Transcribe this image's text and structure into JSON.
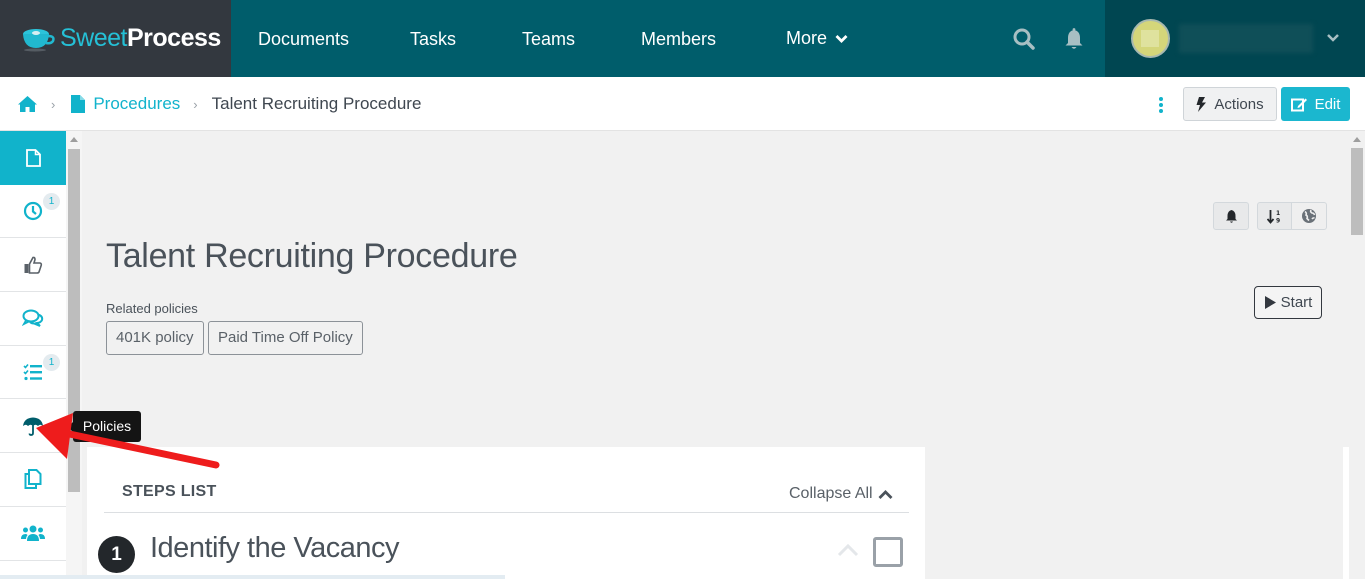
{
  "app": {
    "logo_sweet": "Sweet",
    "logo_process": "Process"
  },
  "topnav": {
    "items": [
      {
        "label": "Documents"
      },
      {
        "label": "Tasks"
      },
      {
        "label": "Teams"
      },
      {
        "label": "Members"
      },
      {
        "label": "More"
      }
    ],
    "search_icon": "search-icon",
    "bell_icon": "bell-icon"
  },
  "breadcrumb": {
    "home_icon": "home-icon",
    "procedures_label": "Procedures",
    "current_label": "Talent Recruiting Procedure",
    "separator": "›"
  },
  "toolbar": {
    "actions_label": "Actions",
    "edit_label": "Edit"
  },
  "sidebar": {
    "items": [
      {
        "icon": "document-icon",
        "active": true,
        "badge": ""
      },
      {
        "icon": "clock-icon",
        "active": false,
        "badge": "1"
      },
      {
        "icon": "thumbs-up-icon",
        "active": false,
        "badge": ""
      },
      {
        "icon": "comments-icon",
        "active": false,
        "badge": ""
      },
      {
        "icon": "checklist-icon",
        "active": false,
        "badge": "1"
      },
      {
        "icon": "umbrella-icon",
        "active": false,
        "badge": ""
      },
      {
        "icon": "copy-icon",
        "active": false,
        "badge": ""
      },
      {
        "icon": "users-icon",
        "active": false,
        "badge": ""
      }
    ]
  },
  "tooltip": {
    "label": "Policies"
  },
  "main": {
    "title": "Talent Recruiting Procedure",
    "related_label": "Related policies",
    "policies": [
      "401K policy",
      "Paid Time Off Policy"
    ],
    "start_label": "Start",
    "steps": {
      "title": "STEPS LIST",
      "collapse_label": "Collapse All",
      "items": [
        {
          "number": "1",
          "title": "Identify the Vacancy"
        }
      ]
    }
  },
  "colors": {
    "brand_teal": "#005d6b",
    "accent_cyan": "#11b3cb",
    "logo_bg": "#33383f",
    "user_bg": "#004651",
    "annotation_arrow": "#ee1c1c"
  }
}
